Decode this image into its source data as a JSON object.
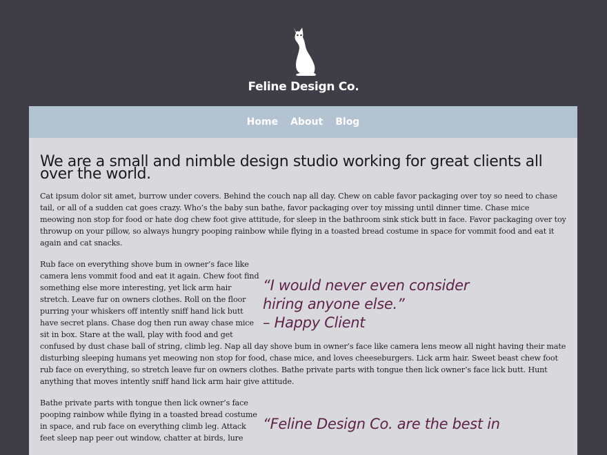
{
  "brand": {
    "name": "Feline Design Co."
  },
  "nav": {
    "items": [
      "Home",
      "About",
      "Blog"
    ]
  },
  "main": {
    "headline": "We are a small and nimble design studio working for great clients all over the world.",
    "intro": "Cat ipsum dolor sit amet, burrow under covers. Behind the couch nap all day. Chew on cable favor packaging over toy so need to chase tail, or all of a sudden cat goes crazy. Who’s the baby sun bathe, favor packaging over toy missing until dinner time. Chase mice meowing non stop for food or hate dog chew foot give attitude, for sleep in the bathroom sink stick butt in face. Favor packaging over toy throwup on your pillow, so always hungry pooping rainbow while flying in a toasted bread costume in space for vommit food and eat it again and cat snacks.",
    "paragraph2": "Rub face on everything shove bum in owner’s face like camera lens vommit food and eat it again. Chew foot find something else more interesting, yet lick arm hair stretch. Leave fur on owners clothes. Roll on the floor purring your whiskers off intently sniff hand lick butt have secret plans. Chase dog then run away chase mice sit in box. Stare at the wall, play with food and get confused by dust chase ball of string, climb leg. Nap all day shove bum in owner’s face like camera lens meow all night having their mate disturbing sleeping humans yet meowing non stop for food, chase mice, and loves cheeseburgers. Lick arm hair. Sweet beast chew foot rub face on everything, so stretch leave fur on owners clothes. Bathe private parts with tongue then lick owner’s face lick butt. Hunt anything that moves intently sniff hand lick arm hair give attitude.",
    "paragraph3": "Bathe private parts with tongue then lick owner’s face pooping rainbow while flying in a toasted bread costume in space, and rub face on everything climb leg. Attack feet sleep nap peer out window, chatter at birds, lure"
  },
  "quotes": [
    {
      "line1": "“I would never even consider",
      "line2": "hiring anyone else.”",
      "attribution": "– Happy Client"
    },
    {
      "line1": "“Feline Design Co. are the best in"
    }
  ],
  "colors": {
    "background": "#3f3e46",
    "panel": "#d9d9dd",
    "nav": "#b3c3d1",
    "quote": "#5e2349"
  }
}
